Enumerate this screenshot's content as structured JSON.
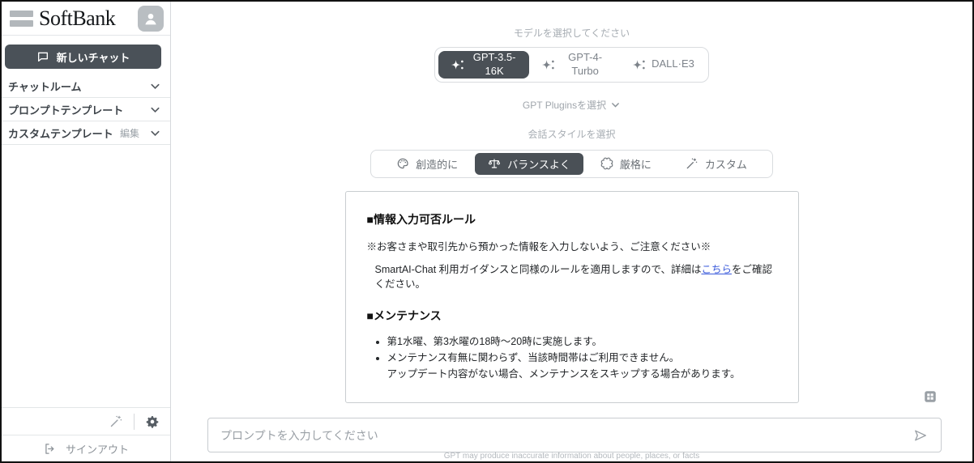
{
  "sidebar": {
    "brand": "SoftBank",
    "new_chat_label": "新しいチャット",
    "menu_items": [
      {
        "label": "チャットルーム"
      },
      {
        "label": "プロンプトテンプレート"
      },
      {
        "label": "カスタムテンプレート",
        "action": "編集"
      }
    ],
    "sign_out_label": "サインアウト"
  },
  "main": {
    "model_select_label": "モデルを選択してください",
    "models": [
      {
        "label": "GPT-3.5-16K",
        "selected": true
      },
      {
        "label": "GPT-4-Turbo",
        "selected": false
      },
      {
        "label": "DALL·E3",
        "selected": false
      }
    ],
    "plugins_label": "GPT Pluginsを選択",
    "style_select_label": "会話スタイルを選択",
    "styles": [
      {
        "label": "創造的に",
        "icon": "palette-icon",
        "selected": false
      },
      {
        "label": "バランスよく",
        "icon": "balance-scale-icon",
        "selected": true
      },
      {
        "label": "厳格に",
        "icon": "seal-icon",
        "selected": false
      },
      {
        "label": "カスタム",
        "icon": "magic-wand-icon",
        "selected": false
      }
    ],
    "notice": {
      "rules_heading": "■情報入力可否ルール",
      "rules_line1": "※お客さまや取引先から預かった情報を入力しないよう、ご注意ください※",
      "rules_line2_pre": "SmartAI-Chat 利用ガイダンスと同様のルールを適用しますので、詳細は",
      "rules_link": "こちら",
      "rules_line2_post": "をご確認ください。",
      "maintenance_heading": "■メンテナンス",
      "maintenance_bullets": [
        "第1水曜、第3水曜の18時〜20時に実施します。",
        "メンテナンス有無に関わらず、当該時間帯はご利用できません。"
      ],
      "maintenance_note": "アップデート内容がない場合、メンテナンスをスキップする場合があります。"
    },
    "prompt_placeholder": "プロンプトを入力してください",
    "footer_disclaimer": "GPT may produce inaccurate information about people, places, or facts"
  },
  "colors": {
    "selected_button_bg": "#4A5056",
    "link_blue": "#3B5BDB",
    "muted_gray": "#9AA0A6",
    "border_gray": "#D9DCDF"
  }
}
